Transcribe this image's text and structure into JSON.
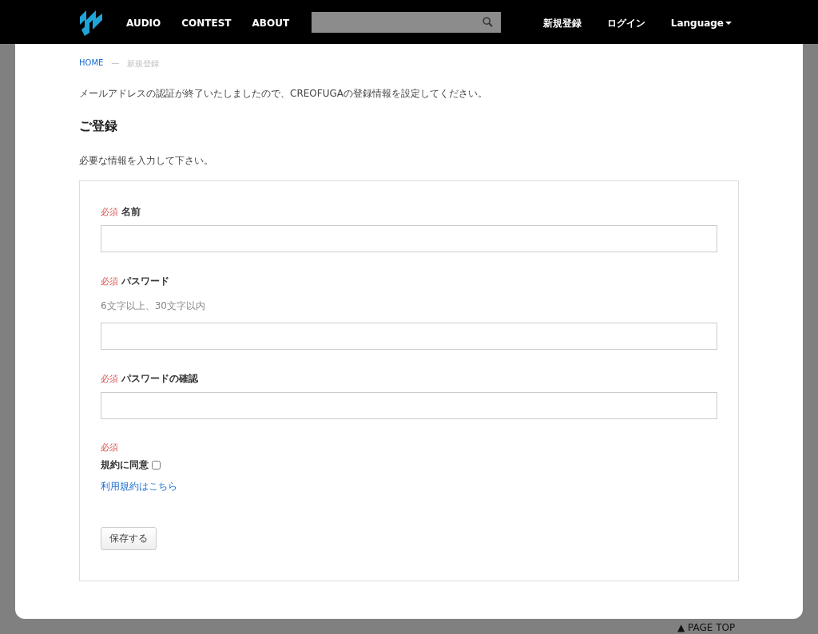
{
  "header": {
    "nav": [
      "AUDIO",
      "CONTEST",
      "ABOUT"
    ],
    "links": [
      "新規登録",
      "ログイン"
    ],
    "language": "Language"
  },
  "breadcrumb": {
    "home": "HOME",
    "separator": "—",
    "current": "新規登録"
  },
  "intro": "メールアドレスの認証が終了いたしましたので、CREOFUGAの登録情報を設定してください。",
  "title": "ご登録",
  "subtitle": "必要な情報を入力して下さい。",
  "fields": [
    {
      "kind": "text",
      "required": "必須",
      "label": "名前"
    },
    {
      "kind": "text",
      "required": "必須",
      "label": "パスワード",
      "hint": "6文字以上、30文字以内"
    },
    {
      "kind": "text",
      "required": "必須",
      "label": "パスワードの確認"
    },
    {
      "kind": "agree",
      "required": "必須",
      "label": "規約に同意",
      "checked": false,
      "link": "利用規約はこちら"
    }
  ],
  "save_button": "保存する",
  "page_top": "▲ PAGE TOP"
}
